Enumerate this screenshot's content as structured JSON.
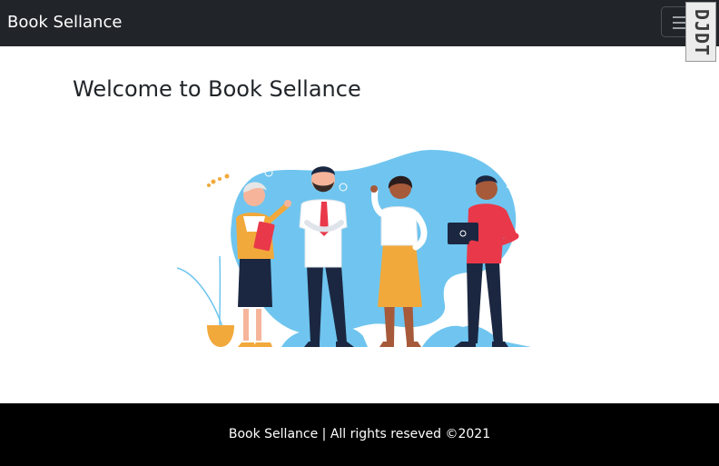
{
  "navbar": {
    "brand": "Book Sellance",
    "menu_icon": "hamburger-menu-icon",
    "background": "#212529"
  },
  "badge": {
    "text": "DJDT"
  },
  "main": {
    "title": "Welcome to Book Sellance",
    "illustration": "team-people-illustration"
  },
  "footer": {
    "text": "Book Sellance | All rights reseved ©2021",
    "background": "#000000"
  },
  "colors": {
    "blob": "#6fc5ef",
    "yellow": "#f2a93b",
    "navy": "#1b2741",
    "red": "#e9384a",
    "skin_light": "#f6b59a",
    "skin_dark": "#a65a3a"
  }
}
